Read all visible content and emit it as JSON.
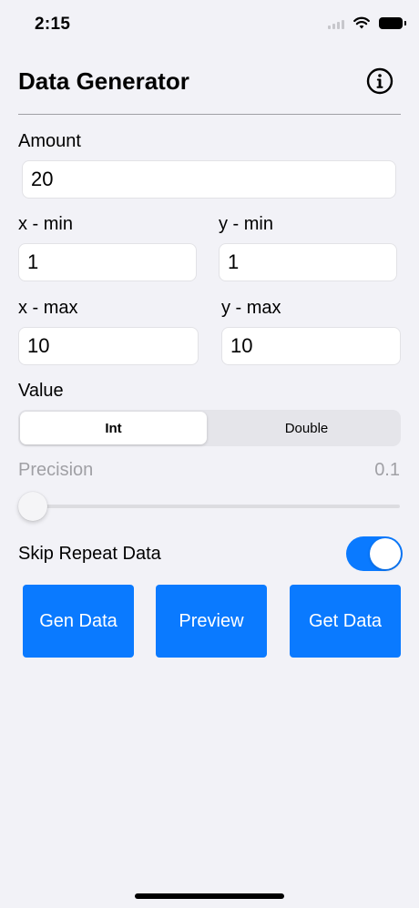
{
  "status_bar": {
    "time": "2:15"
  },
  "header": {
    "title": "Data Generator",
    "info_icon": "info-circle-icon"
  },
  "form": {
    "amount_label": "Amount",
    "amount_value": "20",
    "x_min_label": "x - min",
    "x_min_value": "1",
    "y_min_label": "y - min",
    "y_min_value": "1",
    "x_max_label": "x - max",
    "x_max_value": "10",
    "y_max_label": "y - max",
    "y_max_value": "10",
    "value_label": "Value",
    "value_options": [
      "Int",
      "Double"
    ],
    "value_selected": "Int",
    "precision_label": "Precision",
    "precision_value": "0.1",
    "precision_slider_fraction": 0.0,
    "skip_label": "Skip Repeat Data",
    "skip_on": true
  },
  "actions": {
    "gen_label": "Gen Data",
    "preview_label": "Preview",
    "get_label": "Get Data"
  },
  "colors": {
    "accent": "#0a7aff",
    "background": "#f2f2f7",
    "disabled_text": "#a0a0a5"
  }
}
